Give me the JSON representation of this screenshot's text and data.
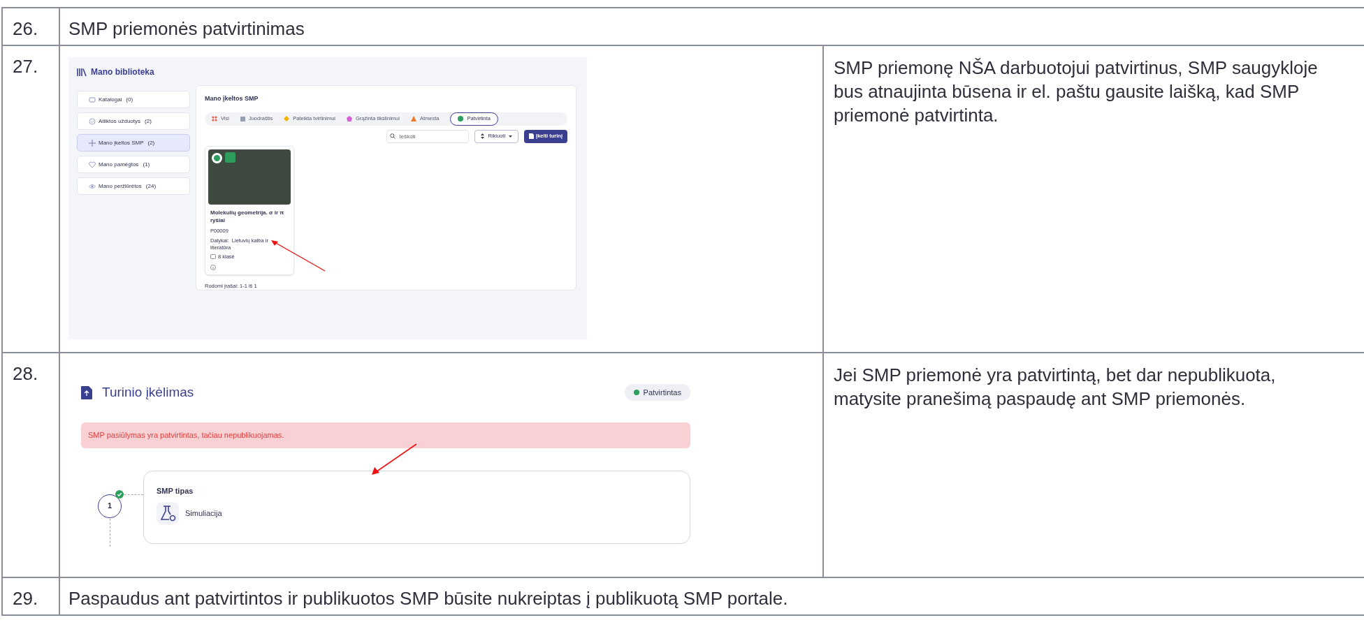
{
  "rows": [
    {
      "number": "26.",
      "kind": "text",
      "text": "SMP priemonės patvirtinimas"
    },
    {
      "number": "27.",
      "kind": "library",
      "note": "SMP priemonę NŠA darbuotojui patvirtinus, SMP saugykloje bus atnaujinta būsena ir el. paštu gausite laišką, kad SMP priemonė patvirtinta.",
      "screen": {
        "title": "Mano biblioteka",
        "sidebar": [
          {
            "label": "Katalogai",
            "count": "(0)",
            "selected": false
          },
          {
            "label": "Atliktos užduotys",
            "count": "(2)",
            "selected": false
          },
          {
            "label": "Mano įkeltos SMP",
            "count": "(2)",
            "selected": true
          },
          {
            "label": "Mano pamėgtos",
            "count": "(1)",
            "selected": false
          },
          {
            "label": "Mano peržiūrėtos",
            "count": "(24)",
            "selected": false
          }
        ],
        "panel_title": "Mano įkeltos SMP",
        "tabs": [
          {
            "label": "Visi",
            "kind": "dots",
            "color": "#e0604a",
            "selected": false
          },
          {
            "label": "Juodraštis",
            "kind": "square",
            "color": "#9aa0b4",
            "selected": false
          },
          {
            "label": "Pateikta tvirtinimui",
            "kind": "diamond",
            "color": "#f5b400",
            "selected": false
          },
          {
            "label": "Grąžinta tikslinimui",
            "kind": "pentagon",
            "color": "#d65fd6",
            "selected": false
          },
          {
            "label": "Atmesta",
            "kind": "triangle",
            "color": "#f07a2a",
            "selected": false
          },
          {
            "label": "Patvirtinta",
            "kind": "circle",
            "color": "#2e9e5e",
            "selected": true
          }
        ],
        "search": {
          "placeholder": "Ieškoti"
        },
        "sort_button": "Rikiuoti",
        "upload_button": "Įkelti turinį",
        "card": {
          "status": {
            "color": "#2e9e5e"
          },
          "title": "Molekulių geometrija. σ ir π ryšiai",
          "code": "P00009",
          "subject": "Dalykai:  Lietuvių kalba ir literatūra",
          "grade": "8 klasė"
        },
        "footer": "Rodomi įrašai: 1-1 iš 1"
      }
    },
    {
      "number": "28.",
      "kind": "upload",
      "note": "Jei SMP priemonė yra patvirtintą, bet dar nepublikuota, matysite pranešimą paspaudę ant SMP priemonės.",
      "screen": {
        "title": "Turinio įkėlimas",
        "status": {
          "label": "Patvirtintas",
          "color": "#2e9e5e"
        },
        "alert": "SMP pasiūlymas yra patvirtintas, tačiau nepublikuojamas.",
        "step": {
          "number": "1",
          "done": true,
          "title": "SMP tipas",
          "value": "Simuliacija"
        }
      }
    },
    {
      "number": "29.",
      "kind": "text",
      "text": "Paspaudus ant patvirtintos ir publikuotos SMP būsite nukreiptas į publikuotą SMP portale."
    }
  ]
}
